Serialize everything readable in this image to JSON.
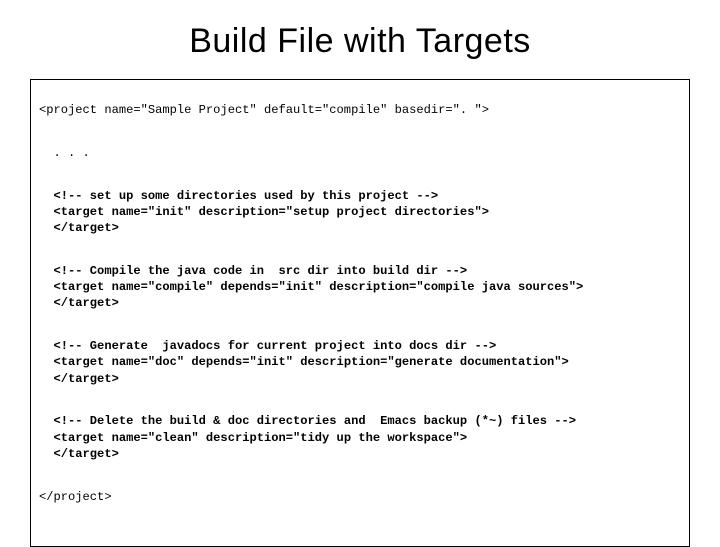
{
  "title": "Build File with Targets",
  "code": {
    "projectOpen": "<project name=\"Sample Project\" default=\"compile\" basedir=\". \">",
    "ellipsis": "  . . .",
    "initComment": "  <!-- set up some directories used by this project -->",
    "initOpen": "  <target name=\"init\" description=\"setup project directories\">",
    "initClose": "  </target>",
    "compileComment": "  <!-- Compile the java code in  src dir into build dir -->",
    "compileOpen": "  <target name=\"compile\" depends=\"init\" description=\"compile java sources\">",
    "compileClose": "  </target>",
    "docComment": "  <!-- Generate  javadocs for current project into docs dir -->",
    "docOpen": "  <target name=\"doc\" depends=\"init\" description=\"generate documentation\">",
    "docClose": "  </target>",
    "cleanComment": "  <!-- Delete the build & doc directories and  Emacs backup (*~) files -->",
    "cleanOpen": "  <target name=\"clean\" description=\"tidy up the workspace\">",
    "cleanClose": "  </target>",
    "projectClose": "</project>"
  }
}
